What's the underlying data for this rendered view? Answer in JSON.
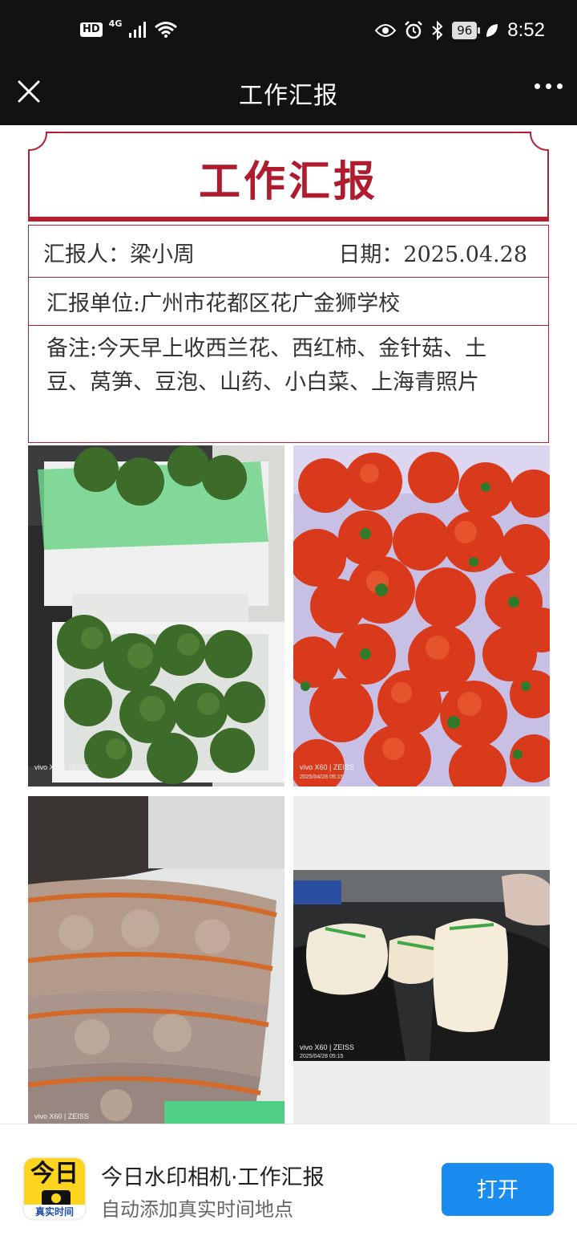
{
  "status_bar": {
    "hd": "HD",
    "network": "4G",
    "battery": "96",
    "time": "8:52"
  },
  "nav": {
    "title": "工作汇报"
  },
  "report": {
    "title": "工作汇报",
    "reporter_label": "汇报人：",
    "reporter": "梁小周",
    "date_label": "日期：",
    "date": "2025.04.28",
    "unit_label": "汇报单位:",
    "unit": "广州市花都区花广金狮学校",
    "remark_label": "备注:",
    "remark": "今天早上收西兰花、西红柿、金针菇、土豆、莴笋、豆泡、山药、小白菜、上海青照片"
  },
  "photos": [
    {
      "subject": "broccoli",
      "watermark": "vivo X60 | ZEISS",
      "timestamp": ""
    },
    {
      "subject": "tomatoes",
      "watermark": "vivo X60 | ZEISS",
      "timestamp": "2025/04/28 05:15"
    },
    {
      "subject": "potatoes",
      "watermark": "vivo X60 | ZEISS",
      "timestamp": ""
    },
    {
      "subject": "enoki-mushrooms",
      "watermark": "vivo X60 | ZEISS",
      "timestamp": "2025/04/28 05:15"
    }
  ],
  "banner": {
    "app_icon_text": "今日",
    "app_icon_strip": "真实时间",
    "title": "今日水印相机·工作汇报",
    "subtitle": "自动添加真实时间地点",
    "open_label": "打开"
  },
  "colors": {
    "accent_red": "#b42032",
    "open_button": "#1a8cf0",
    "app_icon_yellow": "#ffd41e"
  }
}
